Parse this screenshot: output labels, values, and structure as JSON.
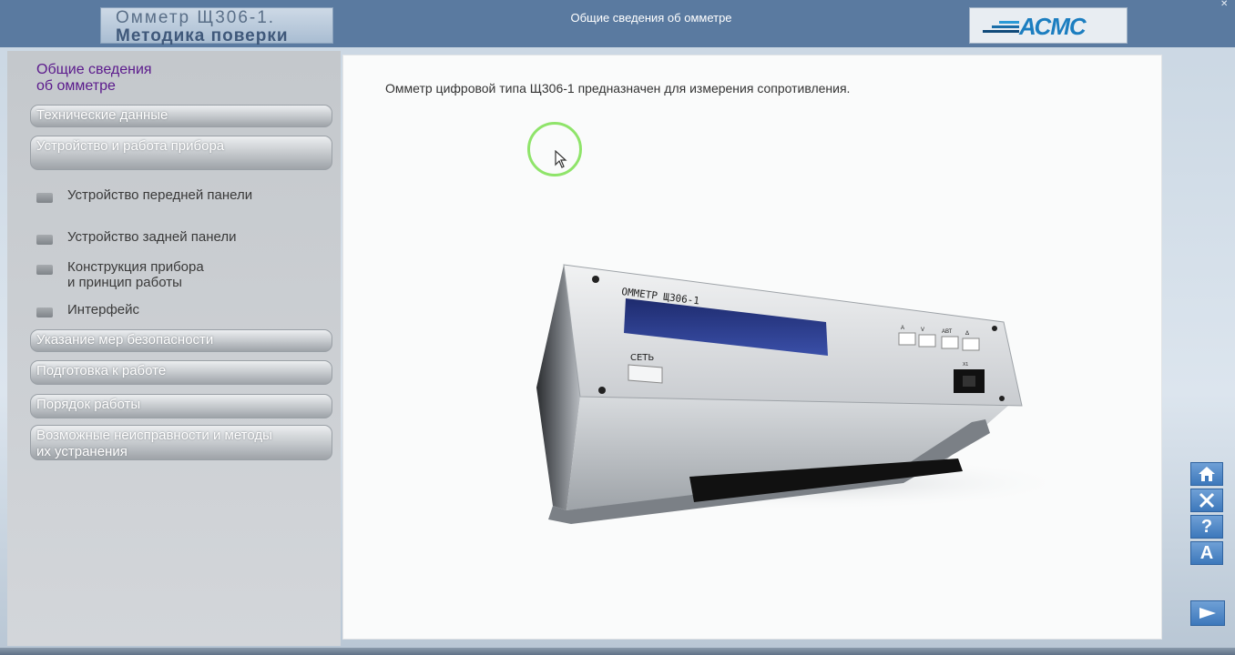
{
  "header": {
    "title_line1": "Омметр Щ306-1.",
    "title_line2": "Методика поверки",
    "section_title": "Общие сведения об омметре",
    "logo": "АСМС"
  },
  "sidebar": {
    "active_item": {
      "line1": "Общие сведения",
      "line2": "об омметре"
    },
    "items": [
      {
        "label": "Технические данные"
      },
      {
        "label": "Устройство и работа прибора"
      },
      {
        "label": "Указание мер безопасности"
      },
      {
        "label": "Подготовка к работе"
      },
      {
        "label": "Порядок работы"
      },
      {
        "label": "Возможные неисправности и методы",
        "label2": "их устранения"
      }
    ],
    "sub_items": [
      {
        "label": "Устройство передней панели"
      },
      {
        "label": "Устройство задней панели"
      },
      {
        "label": "Конструкция прибора",
        "label2": "и принцип работы"
      },
      {
        "label": "Интерфейс"
      }
    ]
  },
  "content": {
    "text": "Омметр цифровой типа Щ306-1 предназначен для измерения сопротивления.",
    "device": {
      "panel_label": "ОММЕТР Щ306-1",
      "power_label": "СЕТЬ",
      "key_labels": [
        "А",
        "V",
        "АВТ",
        "Δ"
      ],
      "socket_label": "X1"
    }
  },
  "controls": {
    "home_icon": "home-icon",
    "close_icon": "close-icon",
    "help_icon": "help-icon",
    "font_icon": "font-icon",
    "next_icon": "next-arrow-icon"
  },
  "colors": {
    "header_bg": "#5a7aa0",
    "active_item": "#5b1a8c",
    "control_blue": "#3d78bb"
  }
}
